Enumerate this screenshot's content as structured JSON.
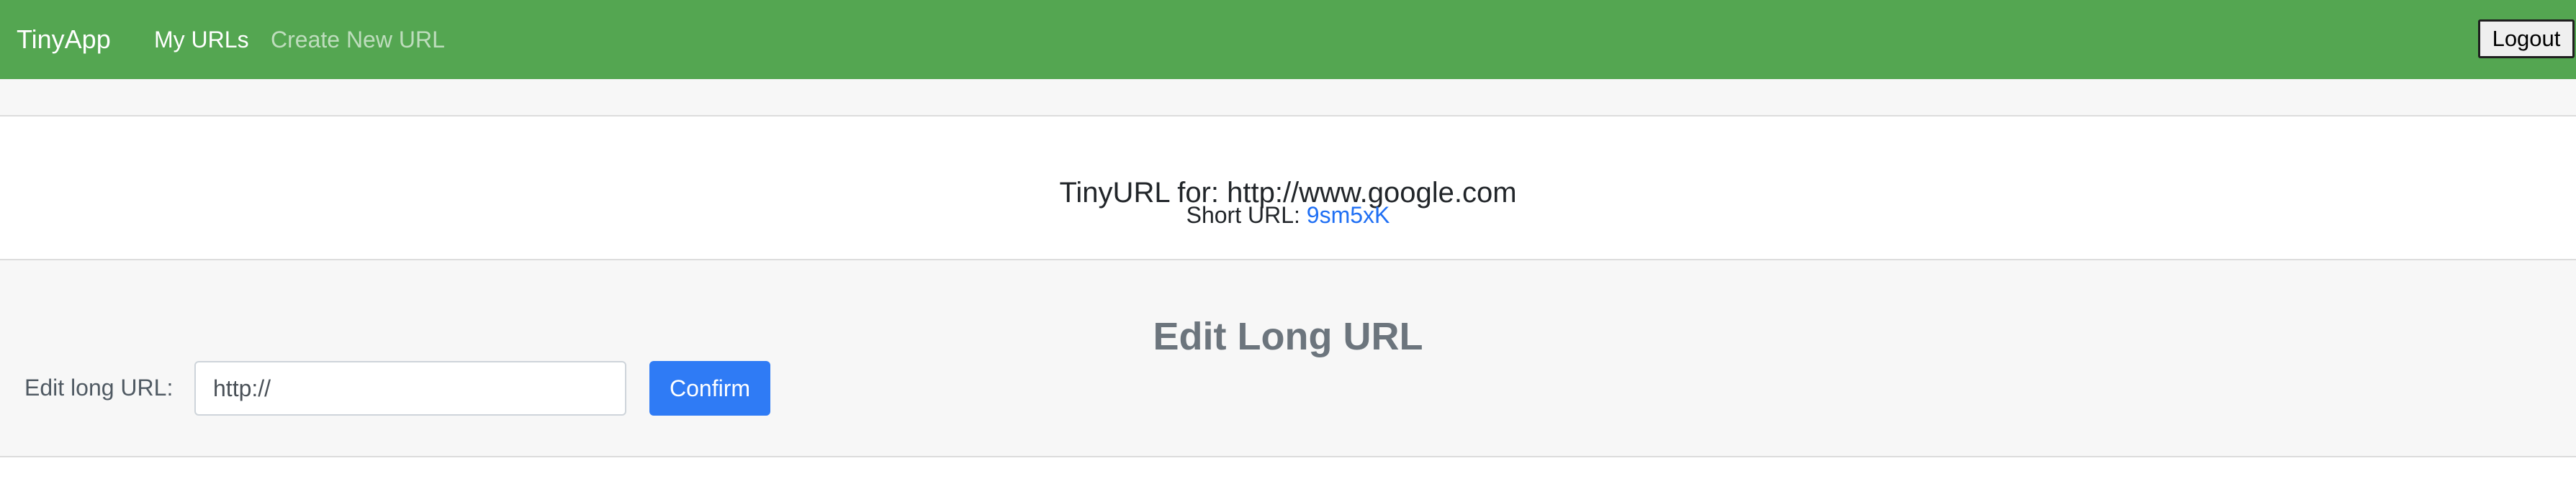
{
  "navbar": {
    "brand": "TinyApp",
    "links": [
      {
        "label": "My URLs"
      },
      {
        "label": "Create New URL"
      }
    ],
    "logout_label": "Logout",
    "color": "#54a651"
  },
  "info": {
    "title": "TinyURL for: http://www.google.com",
    "short_url_label": "Short URL:",
    "short_url_value": "9sm5xK"
  },
  "edit": {
    "title": "Edit Long URL",
    "field_label": "Edit long URL:",
    "input_placeholder": "http://",
    "confirm_label": "Confirm"
  },
  "colors": {
    "accent": "#2f7bf5",
    "link": "#1f6ff4",
    "navbar": "#54a651",
    "section_bg": "#f7f7f7"
  }
}
